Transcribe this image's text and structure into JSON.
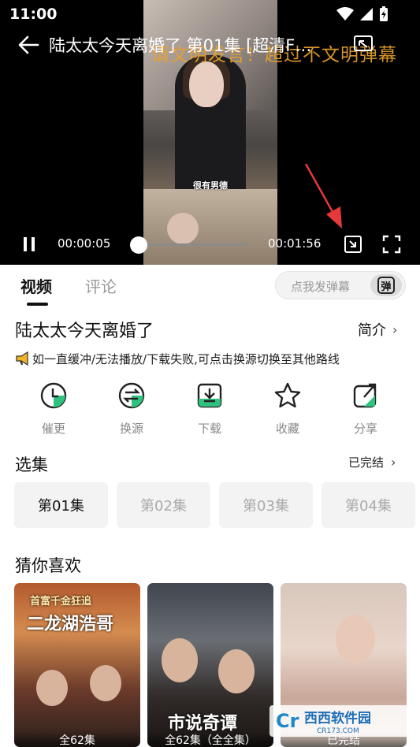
{
  "status_bar": {
    "time": "11:00"
  },
  "player": {
    "title": "陆太太今天离婚了 第01集 [超清F…",
    "danmaku_text": "请文明发言！超过不文明弹幕",
    "subtitle": "很有男德",
    "current_time": "00:00:05",
    "total_time": "00:01:56",
    "progress": 0.043
  },
  "tabs": [
    {
      "label": "视频"
    },
    {
      "label": "评论"
    }
  ],
  "danmaku_input": {
    "placeholder": "点我发弹幕",
    "button": "弹"
  },
  "show": {
    "title": "陆太太今天离婚了",
    "intro_label": "简介",
    "notice": "如一直缓冲/无法播放/下载失败,可点击换源切换至其他路线"
  },
  "actions": [
    {
      "label": "催更",
      "icon": "clock-icon"
    },
    {
      "label": "换源",
      "icon": "switch-source-icon"
    },
    {
      "label": "下载",
      "icon": "download-icon"
    },
    {
      "label": "收藏",
      "icon": "star-icon"
    },
    {
      "label": "分享",
      "icon": "share-icon"
    }
  ],
  "episodes": {
    "section_title": "选集",
    "status": "已完结",
    "items": [
      "第01集",
      "第02集",
      "第03集",
      "第04集"
    ]
  },
  "recommend": {
    "section_title": "猜你喜欢",
    "items": [
      {
        "badge": "全62集",
        "poster_text": "二龙湖浩哥",
        "poster_sub": "首富千金狂追"
      },
      {
        "badge": "全62集（全全集）",
        "poster_text": "市说奇谭"
      },
      {
        "badge": "已完结"
      }
    ]
  },
  "watermark": {
    "text": "西西软件园",
    "sub": "CR173.COM"
  },
  "colors": {
    "accent": "#2ec27e",
    "danmaku": "#e9a02d",
    "arrow": "#e8393a"
  }
}
